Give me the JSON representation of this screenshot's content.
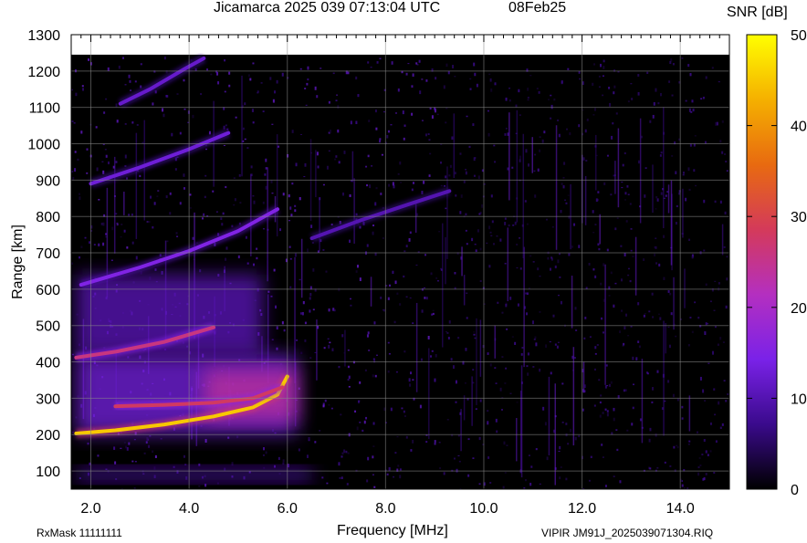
{
  "header": {
    "title": "Jicamarca 2025 039 07:13:04 UTC",
    "date": "08Feb25"
  },
  "footer": {
    "rxmask": "RxMask 11111111",
    "filename": "VIPIR  JM91J_2025039071304.RIQ"
  },
  "chart_data": {
    "type": "heatmap",
    "title": "Jicamarca 2025 039 07:13:04 UTC",
    "subtitle": "08Feb25",
    "xlabel": "Frequency [MHz]",
    "ylabel": "Range [km]",
    "xlim": [
      1.6,
      15.0
    ],
    "ylim": [
      50,
      1300
    ],
    "x_ticks": [
      2.0,
      4.0,
      6.0,
      8.0,
      10.0,
      12.0,
      14.0
    ],
    "x_tick_labels": [
      "2.0",
      "4.0",
      "6.0",
      "8.0",
      "10.0",
      "12.0",
      "14.0"
    ],
    "y_ticks": [
      100,
      200,
      300,
      400,
      500,
      600,
      700,
      800,
      900,
      1000,
      1100,
      1200,
      1300
    ],
    "y_tick_labels": [
      "100",
      "200",
      "300",
      "400",
      "500",
      "600",
      "700",
      "800",
      "900",
      "1000",
      "1100",
      "1200",
      "1300"
    ],
    "grid": true,
    "colorbar": {
      "label": "SNR [dB]",
      "range": [
        0,
        50
      ],
      "ticks": [
        0,
        10,
        20,
        30,
        40,
        50
      ],
      "tick_labels": [
        "0",
        "10",
        "20",
        "30",
        "40",
        "50"
      ],
      "colormap": [
        "#000000",
        "#3a0a8c",
        "#7a22e8",
        "#b42fc0",
        "#d43a5a",
        "#e86a10",
        "#f5b000",
        "#ffff00"
      ]
    },
    "traces": [
      {
        "points": [
          [
            1.7,
            203
          ],
          [
            2.5,
            212
          ],
          [
            3.5,
            228
          ],
          [
            4.5,
            250
          ],
          [
            5.3,
            275
          ],
          [
            5.8,
            310
          ],
          [
            6.0,
            360
          ]
        ],
        "snr": 45
      },
      {
        "points": [
          [
            2.5,
            278
          ],
          [
            3.5,
            282
          ],
          [
            4.5,
            288
          ],
          [
            5.3,
            300
          ],
          [
            5.9,
            330
          ]
        ],
        "snr": 28
      },
      {
        "points": [
          [
            1.7,
            412
          ],
          [
            2.5,
            428
          ],
          [
            3.5,
            455
          ],
          [
            4.5,
            495
          ]
        ],
        "snr": 26
      },
      {
        "points": [
          [
            1.8,
            612
          ],
          [
            3.0,
            660
          ],
          [
            4.0,
            705
          ],
          [
            5.0,
            760
          ],
          [
            5.8,
            820
          ]
        ],
        "snr": 15
      },
      {
        "points": [
          [
            2.0,
            890
          ],
          [
            3.0,
            935
          ],
          [
            4.0,
            985
          ],
          [
            4.8,
            1030
          ]
        ],
        "snr": 13
      },
      {
        "points": [
          [
            2.6,
            1110
          ],
          [
            3.2,
            1150
          ],
          [
            3.9,
            1205
          ],
          [
            4.3,
            1235
          ]
        ],
        "snr": 12
      },
      {
        "points": [
          [
            6.5,
            740
          ],
          [
            7.5,
            790
          ],
          [
            8.5,
            835
          ],
          [
            9.3,
            870
          ]
        ],
        "snr": 10
      }
    ],
    "blobs": [
      {
        "x": [
          1.7,
          6.2
        ],
        "y": [
          200,
          420
        ],
        "snr": 14
      },
      {
        "x": [
          1.7,
          5.5
        ],
        "y": [
          420,
          640
        ],
        "snr": 11
      },
      {
        "x": [
          4.3,
          6.2
        ],
        "y": [
          240,
          380
        ],
        "snr": 24
      },
      {
        "x": [
          1.7,
          6.5
        ],
        "y": [
          70,
          110
        ],
        "snr": 9
      }
    ]
  }
}
